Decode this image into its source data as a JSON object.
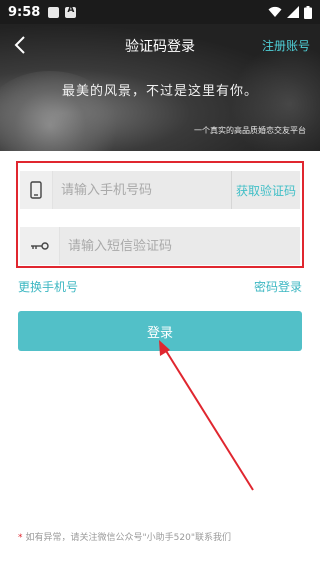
{
  "status_bar": {
    "time": "9:58",
    "icons": [
      "gallery-icon",
      "text-a-icon",
      "wifi-icon",
      "signal-icon",
      "battery-icon"
    ]
  },
  "nav": {
    "back_icon": "chevron-left-icon",
    "title": "验证码登录",
    "register_link": "注册账号"
  },
  "banner": {
    "slogan": "最美的风景，不过是这里有你。",
    "subslogan": "一个真实的高品质婚恋交友平台"
  },
  "form": {
    "phone": {
      "icon": "phone-icon",
      "placeholder": "请输入手机号码",
      "value": "",
      "get_code_label": "获取验证码"
    },
    "code": {
      "icon": "key-icon",
      "placeholder": "请输入短信验证码",
      "value": ""
    }
  },
  "links": {
    "change_phone": "更换手机号",
    "password_login": "密码登录"
  },
  "login_button": {
    "label": "登录"
  },
  "notice": {
    "star": "*",
    "text": "如有异常，请关注微信公众号\"小助手520\"联系我们"
  },
  "colors": {
    "accent": "#52c0c8",
    "link": "#3cb7c2",
    "highlight_box": "#e0262f",
    "status_bar": "#1b1b1b"
  }
}
